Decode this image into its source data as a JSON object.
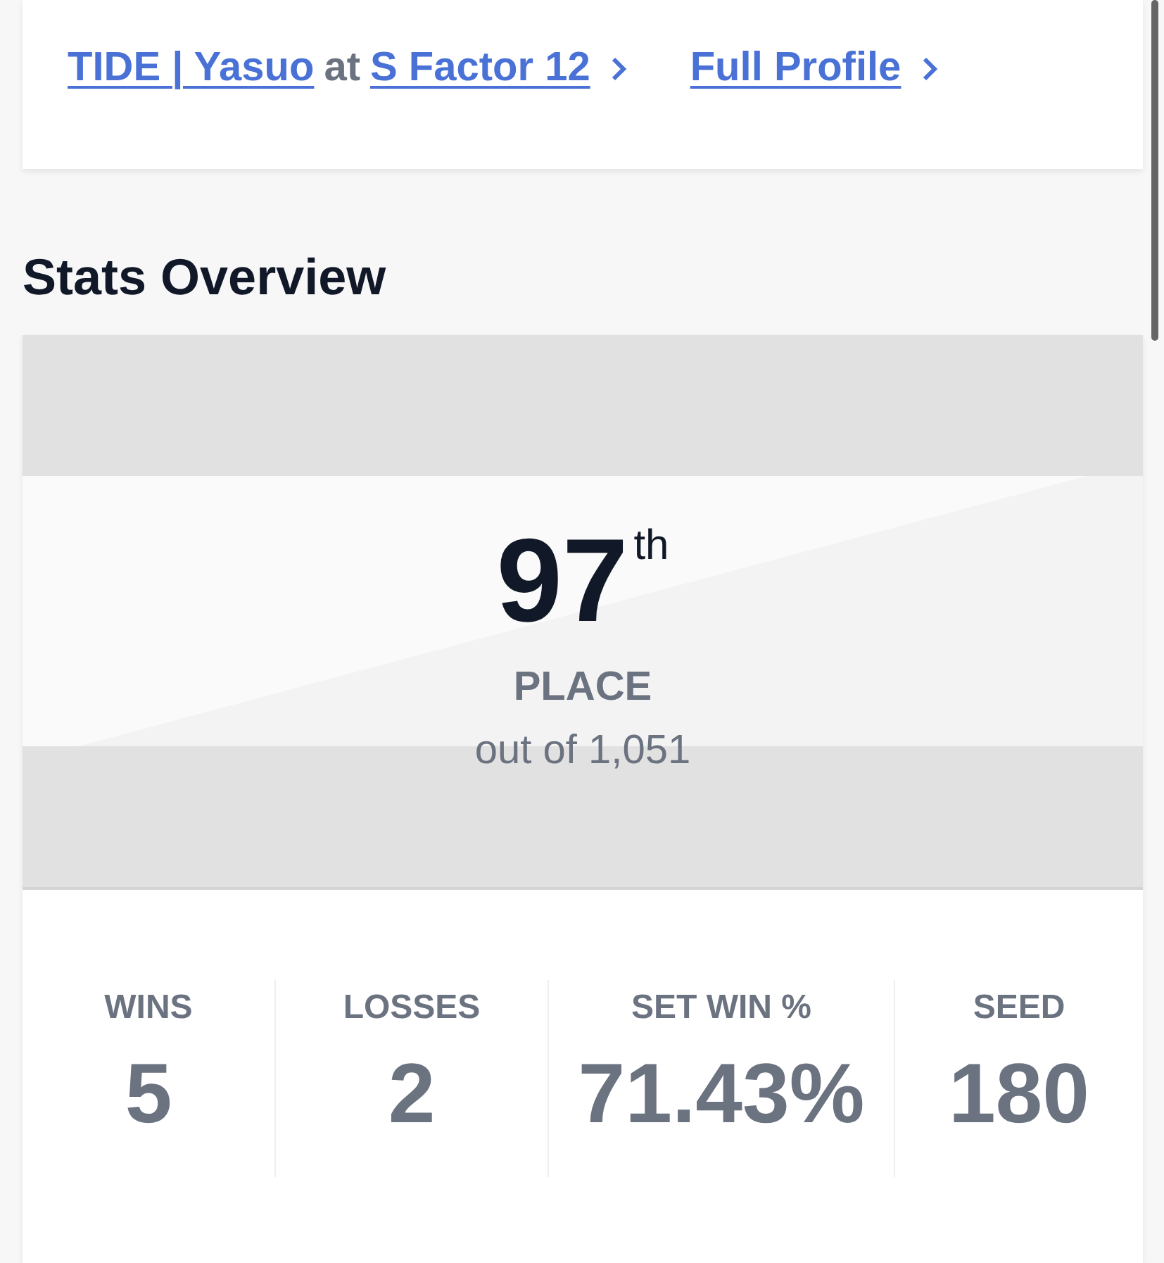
{
  "links": [
    {
      "kind": "event",
      "entrant": "TIDE | Yasuo",
      "joiner": "at",
      "event": "S Factor 12"
    },
    {
      "kind": "profile",
      "label": "Full Profile"
    }
  ],
  "heading": "Stats Overview",
  "placement": {
    "rank": "97$^{th}$",
    "label": "PLACE",
    "total": "out of 1,051"
  },
  "stats": [
    {
      "label": "WINS",
      "value": "5"
    },
    {
      "label": "LOSSES",
      "value": "2"
    },
    {
      "label": "SET WIN %",
      "value": "71.43%"
    },
    {
      "label": "SEED",
      "value": "180"
    }
  ]
}
